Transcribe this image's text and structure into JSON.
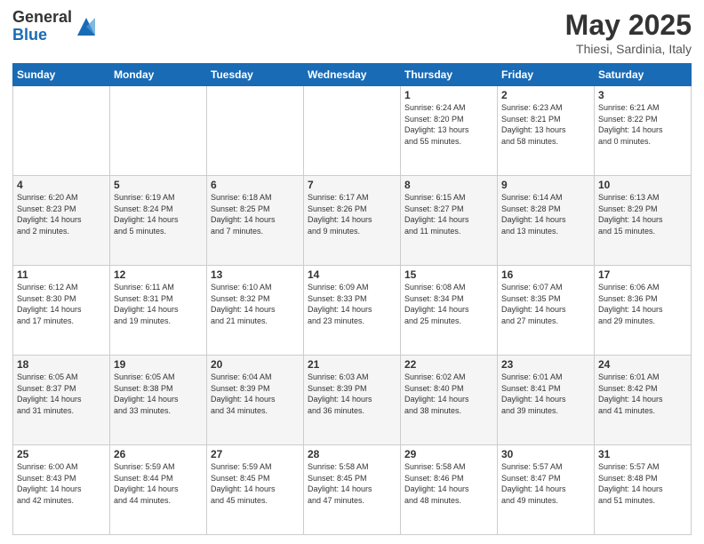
{
  "header": {
    "logo_general": "General",
    "logo_blue": "Blue",
    "month_title": "May 2025",
    "location": "Thiesi, Sardinia, Italy"
  },
  "columns": [
    "Sunday",
    "Monday",
    "Tuesday",
    "Wednesday",
    "Thursday",
    "Friday",
    "Saturday"
  ],
  "weeks": [
    {
      "days": [
        {
          "num": "",
          "info": ""
        },
        {
          "num": "",
          "info": ""
        },
        {
          "num": "",
          "info": ""
        },
        {
          "num": "",
          "info": ""
        },
        {
          "num": "1",
          "info": "Sunrise: 6:24 AM\nSunset: 8:20 PM\nDaylight: 13 hours\nand 55 minutes."
        },
        {
          "num": "2",
          "info": "Sunrise: 6:23 AM\nSunset: 8:21 PM\nDaylight: 13 hours\nand 58 minutes."
        },
        {
          "num": "3",
          "info": "Sunrise: 6:21 AM\nSunset: 8:22 PM\nDaylight: 14 hours\nand 0 minutes."
        }
      ]
    },
    {
      "days": [
        {
          "num": "4",
          "info": "Sunrise: 6:20 AM\nSunset: 8:23 PM\nDaylight: 14 hours\nand 2 minutes."
        },
        {
          "num": "5",
          "info": "Sunrise: 6:19 AM\nSunset: 8:24 PM\nDaylight: 14 hours\nand 5 minutes."
        },
        {
          "num": "6",
          "info": "Sunrise: 6:18 AM\nSunset: 8:25 PM\nDaylight: 14 hours\nand 7 minutes."
        },
        {
          "num": "7",
          "info": "Sunrise: 6:17 AM\nSunset: 8:26 PM\nDaylight: 14 hours\nand 9 minutes."
        },
        {
          "num": "8",
          "info": "Sunrise: 6:15 AM\nSunset: 8:27 PM\nDaylight: 14 hours\nand 11 minutes."
        },
        {
          "num": "9",
          "info": "Sunrise: 6:14 AM\nSunset: 8:28 PM\nDaylight: 14 hours\nand 13 minutes."
        },
        {
          "num": "10",
          "info": "Sunrise: 6:13 AM\nSunset: 8:29 PM\nDaylight: 14 hours\nand 15 minutes."
        }
      ]
    },
    {
      "days": [
        {
          "num": "11",
          "info": "Sunrise: 6:12 AM\nSunset: 8:30 PM\nDaylight: 14 hours\nand 17 minutes."
        },
        {
          "num": "12",
          "info": "Sunrise: 6:11 AM\nSunset: 8:31 PM\nDaylight: 14 hours\nand 19 minutes."
        },
        {
          "num": "13",
          "info": "Sunrise: 6:10 AM\nSunset: 8:32 PM\nDaylight: 14 hours\nand 21 minutes."
        },
        {
          "num": "14",
          "info": "Sunrise: 6:09 AM\nSunset: 8:33 PM\nDaylight: 14 hours\nand 23 minutes."
        },
        {
          "num": "15",
          "info": "Sunrise: 6:08 AM\nSunset: 8:34 PM\nDaylight: 14 hours\nand 25 minutes."
        },
        {
          "num": "16",
          "info": "Sunrise: 6:07 AM\nSunset: 8:35 PM\nDaylight: 14 hours\nand 27 minutes."
        },
        {
          "num": "17",
          "info": "Sunrise: 6:06 AM\nSunset: 8:36 PM\nDaylight: 14 hours\nand 29 minutes."
        }
      ]
    },
    {
      "days": [
        {
          "num": "18",
          "info": "Sunrise: 6:05 AM\nSunset: 8:37 PM\nDaylight: 14 hours\nand 31 minutes."
        },
        {
          "num": "19",
          "info": "Sunrise: 6:05 AM\nSunset: 8:38 PM\nDaylight: 14 hours\nand 33 minutes."
        },
        {
          "num": "20",
          "info": "Sunrise: 6:04 AM\nSunset: 8:39 PM\nDaylight: 14 hours\nand 34 minutes."
        },
        {
          "num": "21",
          "info": "Sunrise: 6:03 AM\nSunset: 8:39 PM\nDaylight: 14 hours\nand 36 minutes."
        },
        {
          "num": "22",
          "info": "Sunrise: 6:02 AM\nSunset: 8:40 PM\nDaylight: 14 hours\nand 38 minutes."
        },
        {
          "num": "23",
          "info": "Sunrise: 6:01 AM\nSunset: 8:41 PM\nDaylight: 14 hours\nand 39 minutes."
        },
        {
          "num": "24",
          "info": "Sunrise: 6:01 AM\nSunset: 8:42 PM\nDaylight: 14 hours\nand 41 minutes."
        }
      ]
    },
    {
      "days": [
        {
          "num": "25",
          "info": "Sunrise: 6:00 AM\nSunset: 8:43 PM\nDaylight: 14 hours\nand 42 minutes."
        },
        {
          "num": "26",
          "info": "Sunrise: 5:59 AM\nSunset: 8:44 PM\nDaylight: 14 hours\nand 44 minutes."
        },
        {
          "num": "27",
          "info": "Sunrise: 5:59 AM\nSunset: 8:45 PM\nDaylight: 14 hours\nand 45 minutes."
        },
        {
          "num": "28",
          "info": "Sunrise: 5:58 AM\nSunset: 8:45 PM\nDaylight: 14 hours\nand 47 minutes."
        },
        {
          "num": "29",
          "info": "Sunrise: 5:58 AM\nSunset: 8:46 PM\nDaylight: 14 hours\nand 48 minutes."
        },
        {
          "num": "30",
          "info": "Sunrise: 5:57 AM\nSunset: 8:47 PM\nDaylight: 14 hours\nand 49 minutes."
        },
        {
          "num": "31",
          "info": "Sunrise: 5:57 AM\nSunset: 8:48 PM\nDaylight: 14 hours\nand 51 minutes."
        }
      ]
    }
  ]
}
